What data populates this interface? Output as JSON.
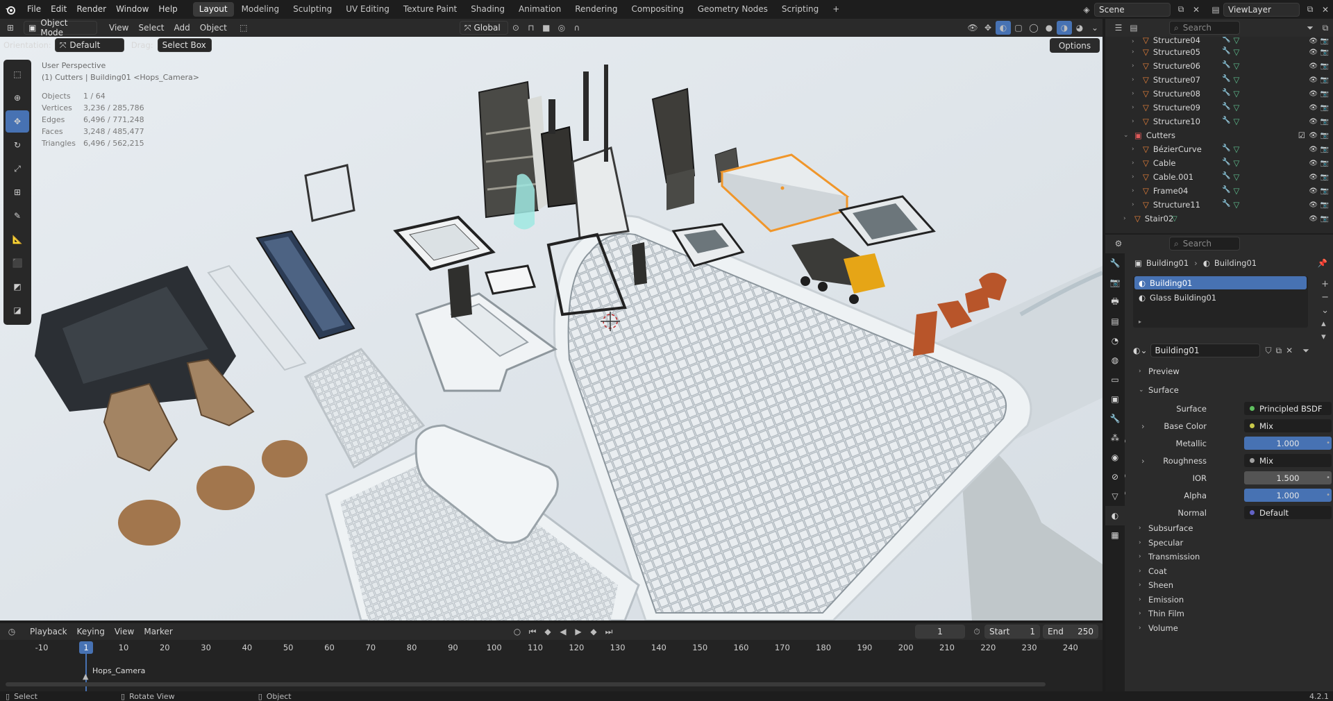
{
  "topbar": {
    "menus": [
      "File",
      "Edit",
      "Render",
      "Window",
      "Help"
    ],
    "workspaces": [
      "Layout",
      "Modeling",
      "Sculpting",
      "UV Editing",
      "Texture Paint",
      "Shading",
      "Animation",
      "Rendering",
      "Compositing",
      "Geometry Nodes",
      "Scripting"
    ],
    "active_workspace": "Layout",
    "add_tab": "+",
    "scene": "Scene",
    "view_layer": "ViewLayer"
  },
  "viewport_header": {
    "mode": "Object Mode",
    "menus": [
      "View",
      "Select",
      "Add",
      "Object"
    ],
    "transform_orientation": "Global"
  },
  "tool_settings": {
    "orientation_label": "Orientation:",
    "orientation_value": "Default",
    "drag_label": "Drag:",
    "drag_value": "Select Box",
    "options": "Options"
  },
  "overlay": {
    "view_name": "User Perspective",
    "context": "(1) Cutters | Building01 <Hops_Camera>",
    "stats": [
      {
        "label": "Objects",
        "value": "1 / 64"
      },
      {
        "label": "Vertices",
        "value": "3,236 / 285,786"
      },
      {
        "label": "Edges",
        "value": "6,496 / 771,248"
      },
      {
        "label": "Faces",
        "value": "3,248 / 485,477"
      },
      {
        "label": "Triangles",
        "value": "6,496 / 562,215"
      }
    ]
  },
  "outliner": {
    "search_placeholder": "Search",
    "rows": [
      {
        "name": "Structure04",
        "type": "object"
      },
      {
        "name": "Structure05",
        "type": "object"
      },
      {
        "name": "Structure06",
        "type": "object"
      },
      {
        "name": "Structure07",
        "type": "object"
      },
      {
        "name": "Structure08",
        "type": "object"
      },
      {
        "name": "Structure09",
        "type": "object"
      },
      {
        "name": "Structure10",
        "type": "object"
      },
      {
        "name": "Cutters",
        "type": "collection"
      },
      {
        "name": "BézierCurve",
        "type": "object"
      },
      {
        "name": "Cable",
        "type": "object"
      },
      {
        "name": "Cable.001",
        "type": "object"
      },
      {
        "name": "Frame04",
        "type": "object"
      },
      {
        "name": "Structure11",
        "type": "object"
      },
      {
        "name": "Stair02",
        "type": "object"
      }
    ]
  },
  "properties": {
    "search_placeholder": "Search",
    "breadcrumb_object": "Building01",
    "breadcrumb_material": "Building01",
    "material_slots": [
      "Building01",
      "Glass Building01"
    ],
    "material_name": "Building01",
    "sections": {
      "preview": "Preview",
      "surface": "Surface"
    },
    "surface_rows": [
      {
        "label": "Surface",
        "value": "Principled BSDF",
        "kind": "link",
        "dot": "#5fbf5f"
      },
      {
        "label": "Base Color",
        "value": "Mix",
        "kind": "link",
        "dot": "#c8c84a",
        "expand": true
      },
      {
        "label": "Metallic",
        "value": "1.000",
        "kind": "slider",
        "dot": "#a1a1a1"
      },
      {
        "label": "Roughness",
        "value": "Mix",
        "kind": "link",
        "dot": "#a1a1a1",
        "expand": true
      },
      {
        "label": "IOR",
        "value": "1.500",
        "kind": "num",
        "dot": "#a1a1a1"
      },
      {
        "label": "Alpha",
        "value": "1.000",
        "kind": "slider",
        "dot": "#a1a1a1"
      },
      {
        "label": "Normal",
        "value": "Default",
        "kind": "link",
        "dot": "#6363c7"
      }
    ],
    "subsections": [
      "Subsurface",
      "Specular",
      "Transmission",
      "Coat",
      "Sheen",
      "Emission",
      "Thin Film",
      "Volume"
    ]
  },
  "timeline": {
    "menus": [
      "Playback",
      "Keying",
      "View",
      "Marker"
    ],
    "current_frame": "1",
    "start_label": "Start",
    "start": "1",
    "end_label": "End",
    "end": "250",
    "ticks": [
      "-10",
      "1",
      "10",
      "20",
      "30",
      "40",
      "50",
      "60",
      "70",
      "80",
      "90",
      "100",
      "110",
      "120",
      "130",
      "140",
      "150",
      "160",
      "170",
      "180",
      "190",
      "200",
      "210",
      "220",
      "230",
      "240"
    ],
    "marker": "Hops_Camera"
  },
  "statusbar": {
    "items": [
      "Select",
      "Rotate View",
      "Object"
    ],
    "version": "4.2.1"
  },
  "colors": {
    "accent": "#4772b3",
    "selected_outline": "#f0962a",
    "object_orange": "#e8823a"
  }
}
